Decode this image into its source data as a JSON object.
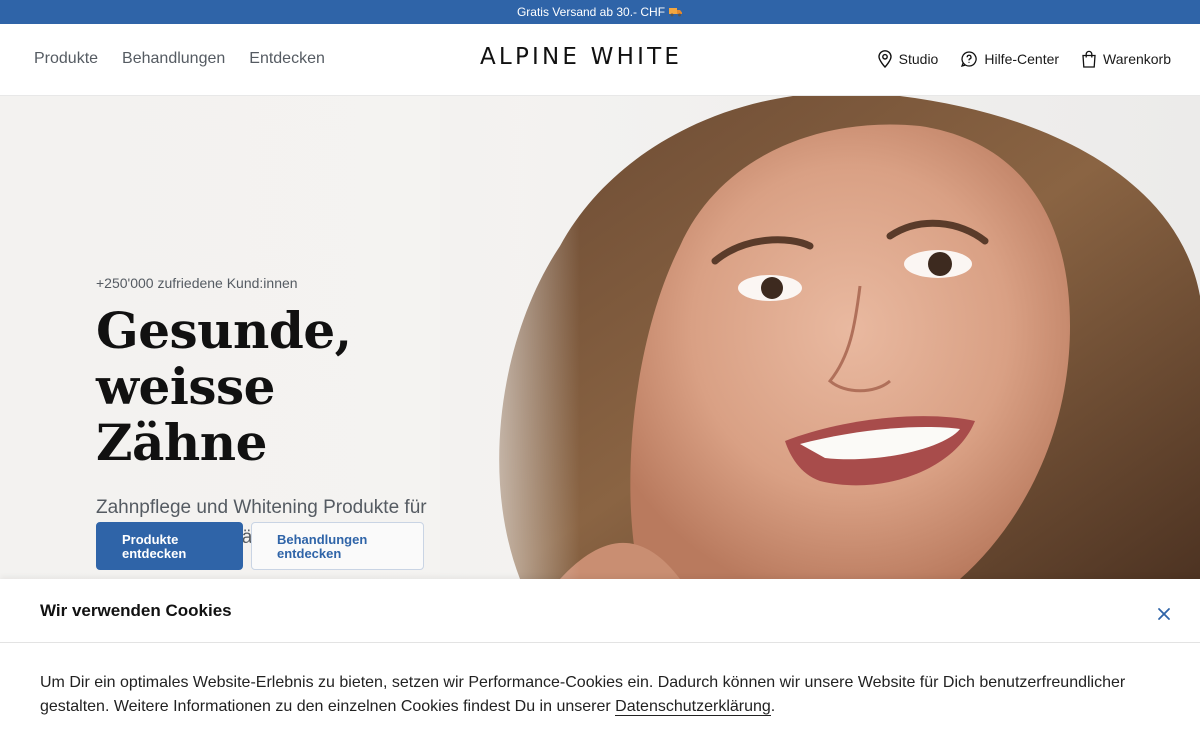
{
  "announcement": {
    "text": "Gratis Versand ab 30.- CHF",
    "icon": "truck-icon"
  },
  "header": {
    "nav_left": [
      "Produkte",
      "Behandlungen",
      "Entdecken"
    ],
    "logo": "ALPINE WHITE",
    "nav_right": [
      {
        "label": "Studio",
        "icon": "location-pin-icon"
      },
      {
        "label": "Hilfe-Center",
        "icon": "help-chat-icon"
      },
      {
        "label": "Warenkorb",
        "icon": "shopping-bag-icon"
      }
    ]
  },
  "hero": {
    "eyebrow": "+250'000 zufriedene Kund:innen",
    "headline_line1": "Gesunde,",
    "headline_line2": "weisse Zähne",
    "subline": "Zahnpflege und Whitening Produkte für Dein schönstes Lächeln.",
    "primary_button": "Produkte entdecken",
    "secondary_button": "Behandlungen entdecken"
  },
  "cookie_banner": {
    "title": "Wir verwenden Cookies",
    "body": "Um Dir ein optimales Website-Erlebnis zu bieten, setzen wir Performance-Cookies ein. Dadurch können wir unsere Website für Dich benutzerfreundlicher gestalten. Weitere Informationen zu den einzelnen Cookies findest Du in unserer ",
    "link": "Datenschutzerklärung",
    "body_end": "."
  },
  "colors": {
    "brand_blue": "#2f64a8",
    "text_muted": "#555b62",
    "text_dark": "#111111"
  }
}
